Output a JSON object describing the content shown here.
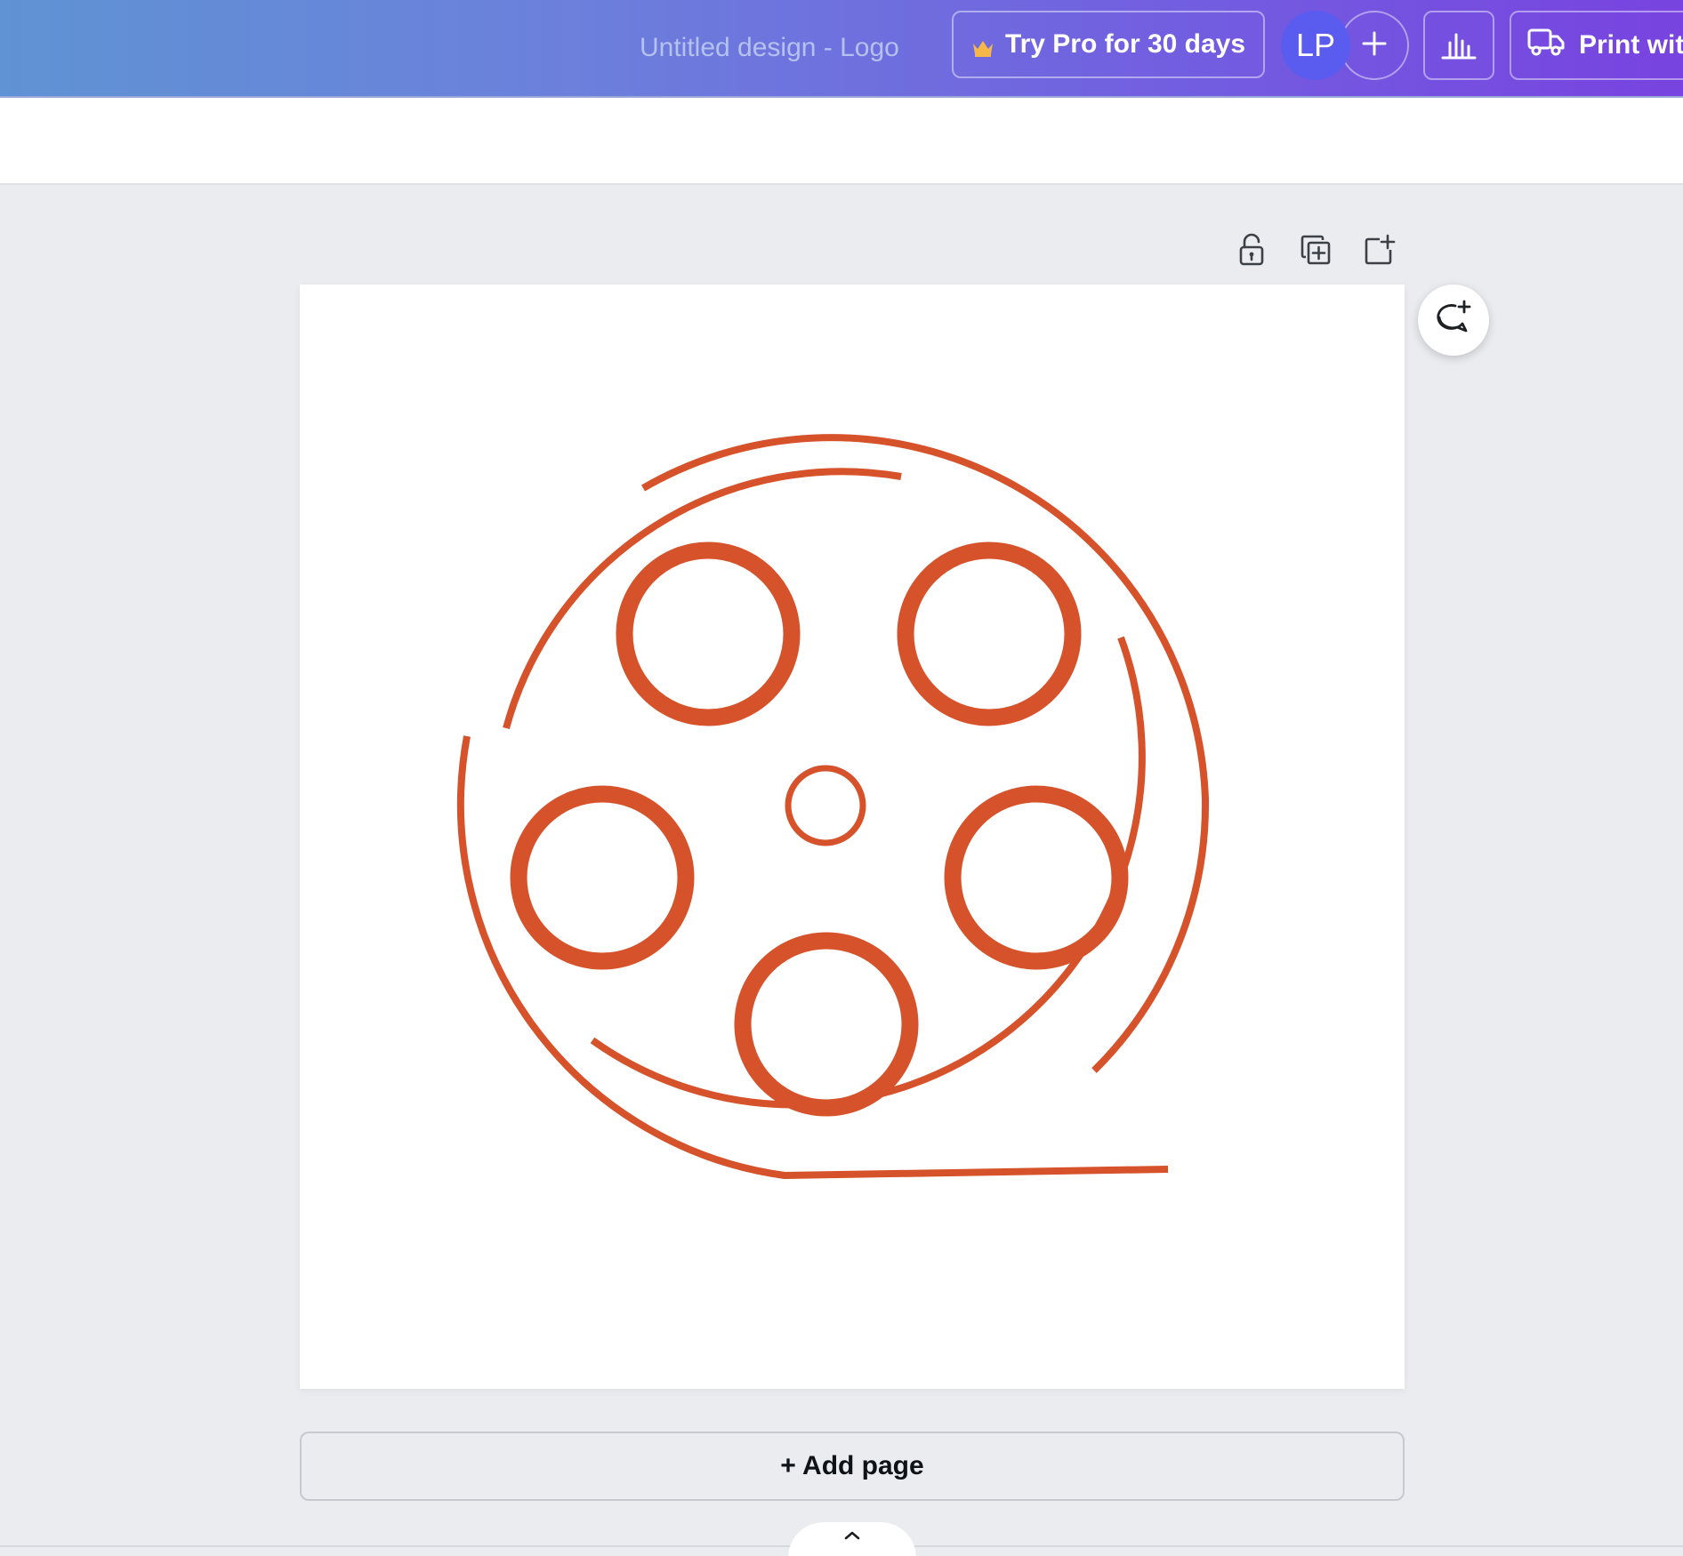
{
  "header": {
    "document_title": "Untitled design - Logo",
    "pro_button_label": "Try Pro for 30 days",
    "avatar_initials": "LP",
    "print_button_label": "Print wit"
  },
  "canvas": {
    "add_page_label": "+ Add page"
  },
  "icons": {
    "crown": "crown-icon",
    "add_member": "plus-icon",
    "insights": "bar-chart-icon",
    "print": "truck-icon",
    "lock": "unlock-icon",
    "duplicate": "duplicate-page-icon",
    "add_page": "add-page-icon",
    "comment": "add-comment-icon",
    "pull_up": "chevron-up-icon"
  },
  "colors": {
    "logo_stroke": "#d6522a",
    "avatar_bg": "#5a5cf0",
    "crown": "#f5b74a"
  }
}
